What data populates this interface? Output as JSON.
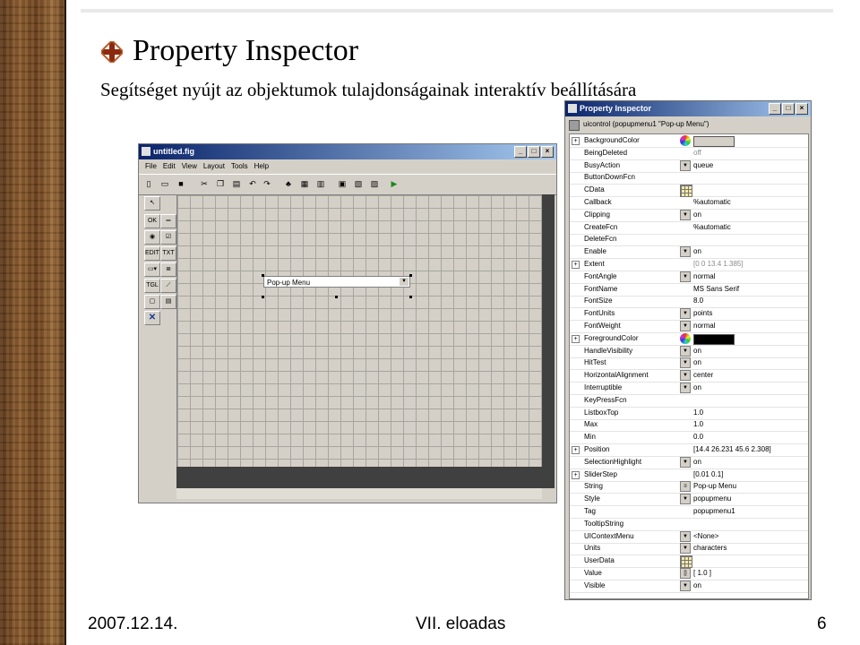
{
  "slide": {
    "title": "Property Inspector",
    "subtitle": "Segítséget nyújt az objektumok tulajdonságainak interaktív beállítására",
    "footer_date": "2007.12.14.",
    "footer_center": "VII. eloadas",
    "page_number": "6"
  },
  "matlab_window": {
    "title": "untitled.fig",
    "menu": [
      "File",
      "Edit",
      "View",
      "Layout",
      "Tools",
      "Help"
    ],
    "popup_label": "Pop-up Menu"
  },
  "inspector": {
    "title": "Property Inspector",
    "object": "uicontrol (popupmenu1 \"Pop-up Menu\")",
    "colors": {
      "background": "#d4d0c8",
      "foreground": "#000000"
    },
    "properties": [
      {
        "name": "BackgroundColor",
        "value": "",
        "expand": true,
        "widget": "color-wheel",
        "swatch": "#d4d0c8"
      },
      {
        "name": "BeingDeleted",
        "value": "off",
        "disabled": true
      },
      {
        "name": "BusyAction",
        "value": "queue",
        "widget": "dropdown"
      },
      {
        "name": "ButtonDownFcn",
        "value": ""
      },
      {
        "name": "CData",
        "value": "",
        "widget": "table"
      },
      {
        "name": "Callback",
        "value": "%automatic"
      },
      {
        "name": "Clipping",
        "value": "on",
        "widget": "dropdown"
      },
      {
        "name": "CreateFcn",
        "value": "%automatic"
      },
      {
        "name": "DeleteFcn",
        "value": ""
      },
      {
        "name": "Enable",
        "value": "on",
        "widget": "dropdown"
      },
      {
        "name": "Extent",
        "value": "[0 0 13.4 1.385]",
        "expand": true,
        "disabled": true
      },
      {
        "name": "FontAngle",
        "value": "normal",
        "widget": "dropdown"
      },
      {
        "name": "FontName",
        "value": "MS Sans Serif"
      },
      {
        "name": "FontSize",
        "value": "8.0"
      },
      {
        "name": "FontUnits",
        "value": "points",
        "widget": "dropdown"
      },
      {
        "name": "FontWeight",
        "value": "normal",
        "widget": "dropdown"
      },
      {
        "name": "ForegroundColor",
        "value": "",
        "expand": true,
        "widget": "color-wheel",
        "swatch": "#000000"
      },
      {
        "name": "HandleVisibility",
        "value": "on",
        "widget": "dropdown"
      },
      {
        "name": "HitTest",
        "value": "on",
        "widget": "dropdown"
      },
      {
        "name": "HorizontalAlignment",
        "value": "center",
        "widget": "dropdown"
      },
      {
        "name": "Interruptible",
        "value": "on",
        "widget": "dropdown"
      },
      {
        "name": "KeyPressFcn",
        "value": ""
      },
      {
        "name": "ListboxTop",
        "value": "1.0"
      },
      {
        "name": "Max",
        "value": "1.0"
      },
      {
        "name": "Min",
        "value": "0.0"
      },
      {
        "name": "Position",
        "value": "[14.4 26.231 45.6 2.308]",
        "expand": true
      },
      {
        "name": "SelectionHighlight",
        "value": "on",
        "widget": "dropdown"
      },
      {
        "name": "SliderStep",
        "value": "[0.01 0.1]",
        "expand": true
      },
      {
        "name": "String",
        "value": "Pop-up Menu",
        "widget": "list"
      },
      {
        "name": "Style",
        "value": "popupmenu",
        "widget": "dropdown"
      },
      {
        "name": "Tag",
        "value": "popupmenu1"
      },
      {
        "name": "TooltipString",
        "value": ""
      },
      {
        "name": "UIContextMenu",
        "value": "<None>",
        "widget": "dropdown"
      },
      {
        "name": "Units",
        "value": "characters",
        "widget": "dropdown"
      },
      {
        "name": "UserData",
        "value": "",
        "widget": "table"
      },
      {
        "name": "Value",
        "value": "[ 1.0 ]",
        "widget": "matrix"
      },
      {
        "name": "Visible",
        "value": "on",
        "widget": "dropdown"
      }
    ]
  }
}
